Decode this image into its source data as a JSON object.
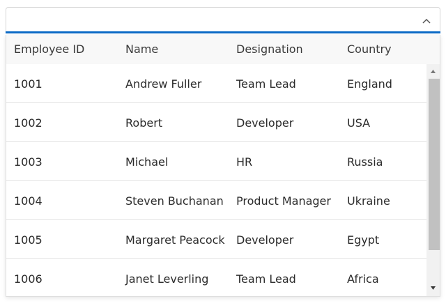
{
  "combo": {
    "value": "",
    "placeholder": "",
    "toggle_icon": "chevron-up-icon"
  },
  "grid": {
    "columns": [
      "Employee ID",
      "Name",
      "Designation",
      "Country"
    ],
    "rows": [
      [
        "1001",
        "Andrew Fuller",
        "Team Lead",
        "England"
      ],
      [
        "1002",
        "Robert",
        "Developer",
        "USA"
      ],
      [
        "1003",
        "Michael",
        "HR",
        "Russia"
      ],
      [
        "1004",
        "Steven Buchanan",
        "Product Manager",
        "Ukraine"
      ],
      [
        "1005",
        "Margaret Peacock",
        "Developer",
        "Egypt"
      ],
      [
        "1006",
        "Janet Leverling",
        "Team Lead",
        "Africa"
      ]
    ]
  },
  "scrollbar": {
    "up_icon": "scroll-up-arrow-icon",
    "down_icon": "scroll-down-arrow-icon"
  },
  "colors": {
    "accent": "#0c6bc6",
    "header_bg": "#f8f8f8",
    "thumb": "#c1c1c1"
  }
}
